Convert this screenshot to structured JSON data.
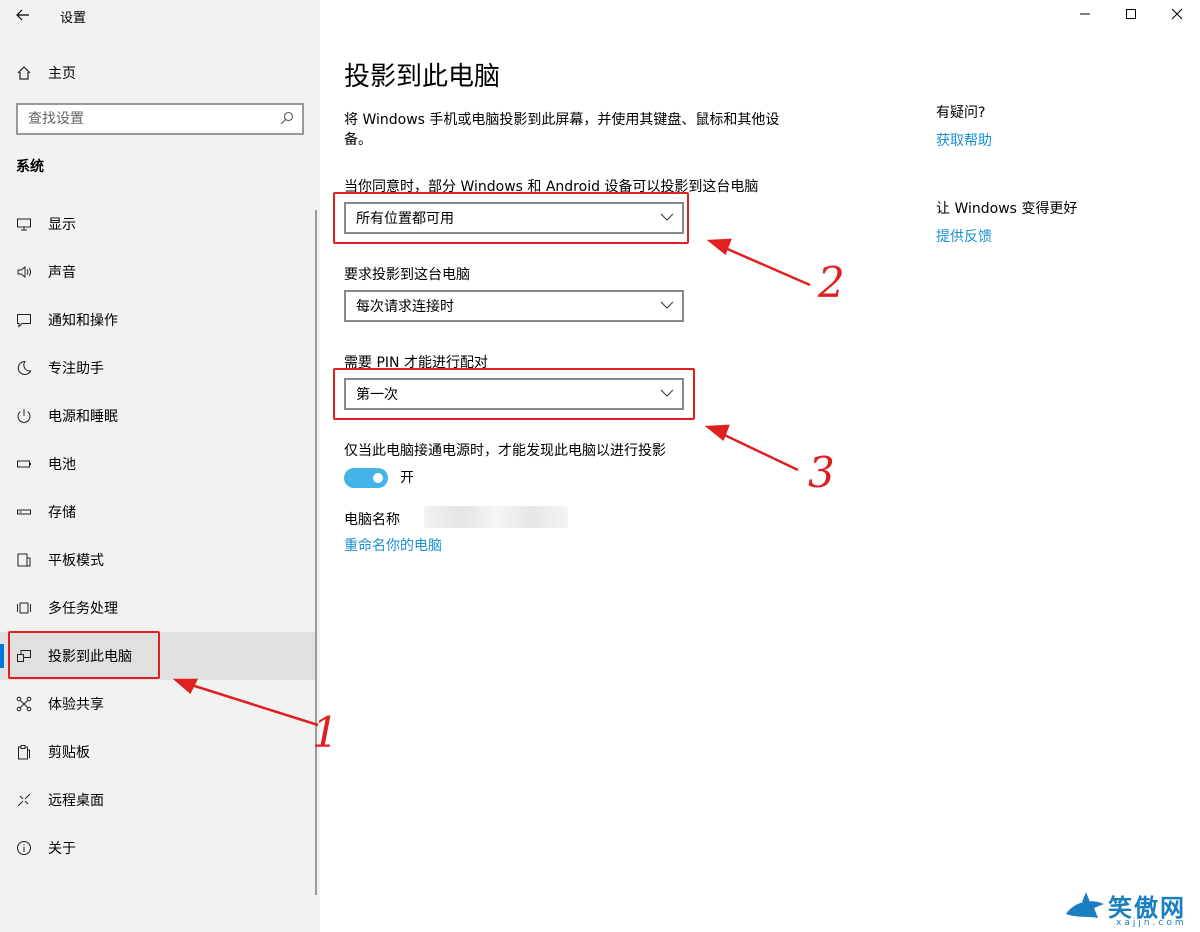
{
  "window": {
    "title": "设置",
    "back_icon": "back-arrow-icon",
    "controls": [
      "minimize",
      "maximize",
      "close"
    ]
  },
  "sidebar": {
    "home_label": "主页",
    "search_placeholder": "查找设置",
    "section": "系统",
    "items": [
      {
        "label": "显示",
        "icon": "display-icon"
      },
      {
        "label": "声音",
        "icon": "sound-icon"
      },
      {
        "label": "通知和操作",
        "icon": "notification-icon"
      },
      {
        "label": "专注助手",
        "icon": "moon-icon"
      },
      {
        "label": "电源和睡眠",
        "icon": "power-icon"
      },
      {
        "label": "电池",
        "icon": "battery-icon"
      },
      {
        "label": "存储",
        "icon": "storage-icon"
      },
      {
        "label": "平板模式",
        "icon": "tablet-icon"
      },
      {
        "label": "多任务处理",
        "icon": "multitask-icon"
      },
      {
        "label": "投影到此电脑",
        "icon": "project-icon",
        "active": true
      },
      {
        "label": "体验共享",
        "icon": "share-icon"
      },
      {
        "label": "剪贴板",
        "icon": "clipboard-icon"
      },
      {
        "label": "远程桌面",
        "icon": "remote-icon"
      },
      {
        "label": "关于",
        "icon": "info-icon"
      }
    ]
  },
  "main": {
    "title": "投影到此电脑",
    "description": "将 Windows 手机或电脑投影到此屏幕，并使用其键盘、鼠标和其他设备。",
    "availability": {
      "label": "当你同意时，部分 Windows 和 Android 设备可以投影到这台电脑",
      "value": "所有位置都可用"
    },
    "ask_to_project": {
      "label": "要求投影到这台电脑",
      "value": "每次请求连接时"
    },
    "require_pin": {
      "label": "需要 PIN 才能进行配对",
      "value": "第一次"
    },
    "power_only": {
      "label": "仅当此电脑接通电源时，才能发现此电脑以进行投影",
      "state": "开",
      "on": true
    },
    "pc_name_label": "电脑名称",
    "rename_link": "重命名你的电脑"
  },
  "help": {
    "question_title": "有疑问?",
    "get_help": "获取帮助",
    "improve_title": "让 Windows 变得更好",
    "feedback": "提供反馈"
  },
  "annotations": {
    "color": "#e02020",
    "labels": [
      "1",
      "2",
      "3"
    ]
  },
  "watermark": {
    "text": "笑傲网",
    "sub": "xajjn.com"
  }
}
